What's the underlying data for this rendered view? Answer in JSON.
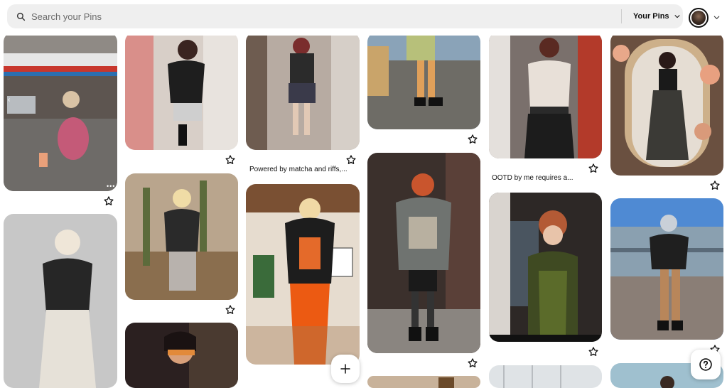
{
  "search": {
    "placeholder": "Search your Pins",
    "value": ""
  },
  "header": {
    "filter_label": "Your Pins"
  },
  "icons": {
    "search": "search-icon",
    "chevron": "chevron-down-icon",
    "star": "star-icon",
    "plus": "plus-icon",
    "help": "help-icon"
  },
  "captions": {
    "col3_pin1": "Powered by matcha and riffs,...",
    "col5_pin1": "OOTD by me requires a..."
  },
  "pins": [
    {
      "id": "c1p1",
      "palette": "#8a6a6a"
    },
    {
      "id": "c1p2",
      "palette": "#bdbdbd"
    },
    {
      "id": "c2p1",
      "palette": "#cfc1b9"
    },
    {
      "id": "c2p2",
      "palette": "#9a7a5b"
    },
    {
      "id": "c2p3",
      "palette": "#3a2a2a"
    },
    {
      "id": "c3p1",
      "palette": "#8d7c70"
    },
    {
      "id": "c3p2",
      "palette": "#5b4a3e"
    },
    {
      "id": "c3p3",
      "palette": "#d7c8b8"
    },
    {
      "id": "c4p1",
      "palette": "#5e5c57"
    },
    {
      "id": "c4p2",
      "palette": "#4a3b36"
    },
    {
      "id": "c4p3",
      "palette": "#c8b29a"
    },
    {
      "id": "c5p1",
      "palette": "#6c6461"
    },
    {
      "id": "c5p2",
      "palette": "#2e2a2a"
    },
    {
      "id": "c5p3",
      "palette": "#d7dce0"
    },
    {
      "id": "c6p1",
      "palette": "#7a6148"
    },
    {
      "id": "c6p2",
      "palette": "#6f8fb3"
    },
    {
      "id": "c6p3",
      "palette": "#9fc0cf"
    }
  ]
}
